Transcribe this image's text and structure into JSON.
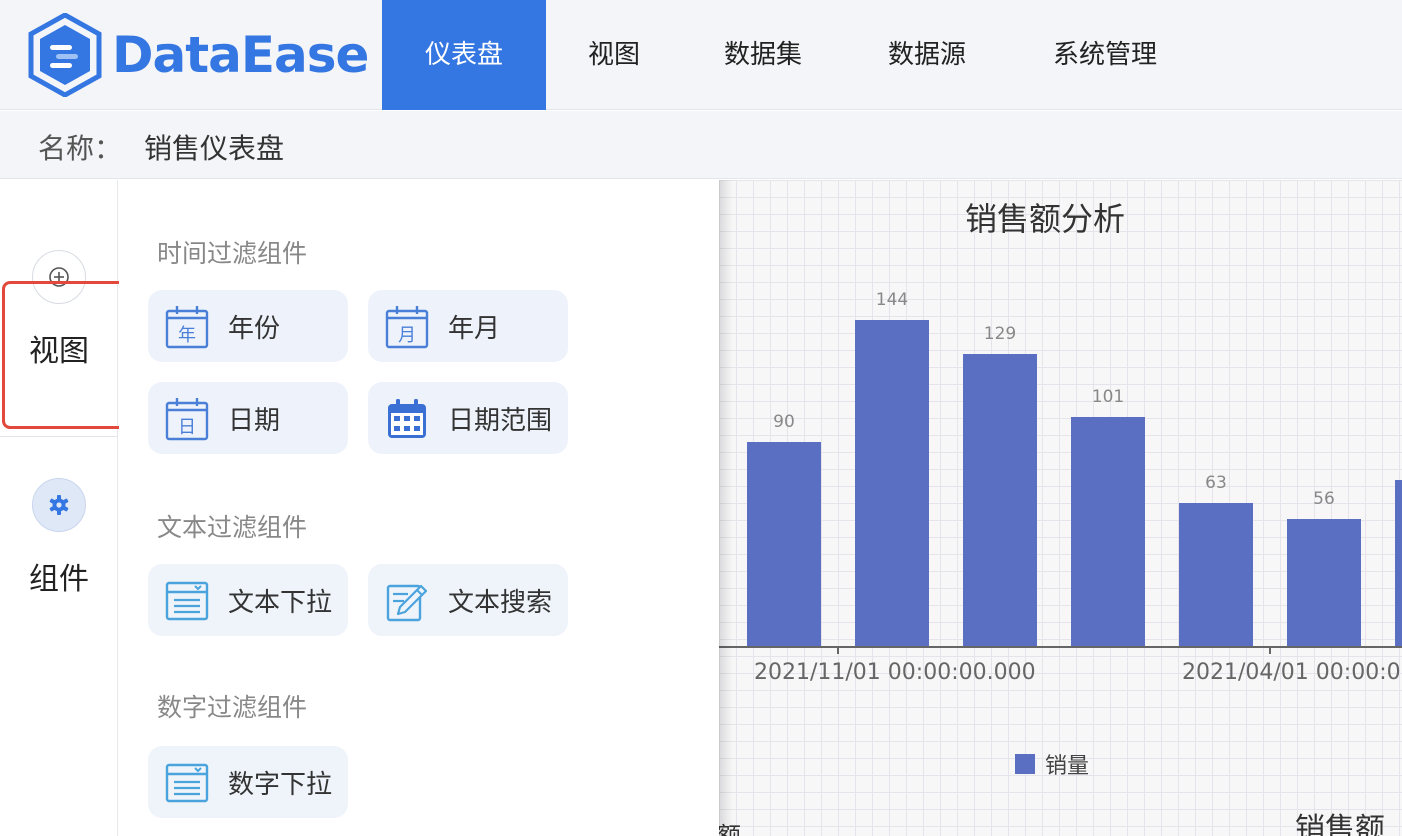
{
  "app": {
    "logo_text": "DataEase",
    "brand_color": "#3476e2"
  },
  "nav": {
    "items": [
      {
        "label": "仪表盘",
        "active": true
      },
      {
        "label": "视图",
        "active": false
      },
      {
        "label": "数据集",
        "active": false
      },
      {
        "label": "数据源",
        "active": false
      },
      {
        "label": "系统管理",
        "active": false
      }
    ]
  },
  "titlebar": {
    "name_label": "名称：",
    "name_value": "销售仪表盘"
  },
  "rail": {
    "items": [
      {
        "label": "视图",
        "icon": "plus-circle-icon",
        "active": false
      },
      {
        "label": "组件",
        "icon": "gear-icon",
        "active": true
      }
    ]
  },
  "panel": {
    "sections": [
      {
        "title": "时间过滤组件",
        "items": [
          {
            "label": "年份",
            "icon": "calendar-year-icon",
            "icon_char": "年"
          },
          {
            "label": "年月",
            "icon": "calendar-month-icon",
            "icon_char": "月"
          },
          {
            "label": "日期",
            "icon": "calendar-day-icon",
            "icon_char": "日"
          },
          {
            "label": "日期范围",
            "icon": "calendar-range-icon"
          }
        ]
      },
      {
        "title": "文本过滤组件",
        "items": [
          {
            "label": "文本下拉",
            "icon": "dropdown-list-icon"
          },
          {
            "label": "文本搜索",
            "icon": "edit-search-icon"
          }
        ]
      },
      {
        "title": "数字过滤组件",
        "items": [
          {
            "label": "数字下拉",
            "icon": "dropdown-list-icon"
          }
        ]
      }
    ]
  },
  "chart_data": {
    "type": "bar",
    "title": "销售额分析",
    "categories": [
      "2021/11/01 00:00:00.000",
      "",
      "",
      "",
      "2021/04/01 00:00:0",
      "",
      ""
    ],
    "series": [
      {
        "name": "销量",
        "values": [
          90,
          144,
          129,
          101,
          63,
          56,
          null
        ],
        "color": "#5b6fc2"
      }
    ],
    "ylim": [
      0,
      150
    ],
    "grid": true,
    "legend": "bottom-center",
    "bar_color": "#5b6fc2"
  },
  "canvas": {
    "next_chart_title": "销售额",
    "left_fragment": "额"
  }
}
